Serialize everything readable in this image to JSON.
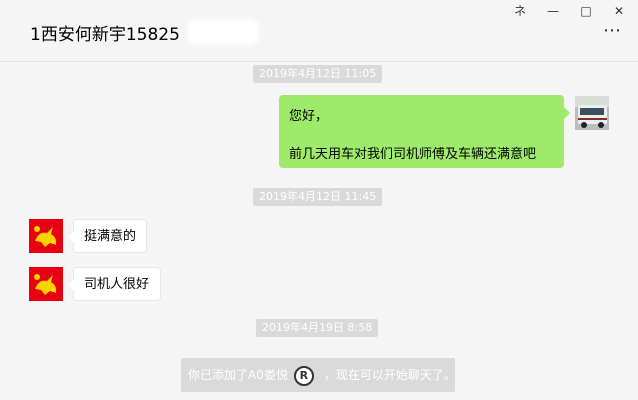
{
  "window": {
    "title": "1西安何新宇15825",
    "controls": [
      "ネ",
      "—",
      "□",
      "✕"
    ],
    "more_icon": "⋯"
  },
  "messages": [
    {
      "type": "timestamp",
      "text": "2019年4月12日 11:05"
    },
    {
      "type": "outgoing",
      "lines": [
        "您好，",
        "前几天用车对我们司机师傅及车辆还满意吧"
      ]
    },
    {
      "type": "timestamp",
      "text": "2019年4月12日 11:45"
    },
    {
      "type": "incoming",
      "text": "挺满意的"
    },
    {
      "type": "incoming",
      "text": "司机人很好"
    },
    {
      "type": "timestamp",
      "text": "2019年4月19日 8:58"
    }
  ],
  "system_notice": {
    "before": "你已添加了A0娄悦",
    "symbol": "R",
    "after": "，现在可以开始聊天了。"
  },
  "colors": {
    "background": "#f5f5f5",
    "outgoing_bubble": "#9eea6a",
    "incoming_bubble": "#ffffff",
    "timestamp_bg": "#dadada",
    "avatar_red": "#e60012",
    "avatar_yellow": "#ffd200"
  }
}
